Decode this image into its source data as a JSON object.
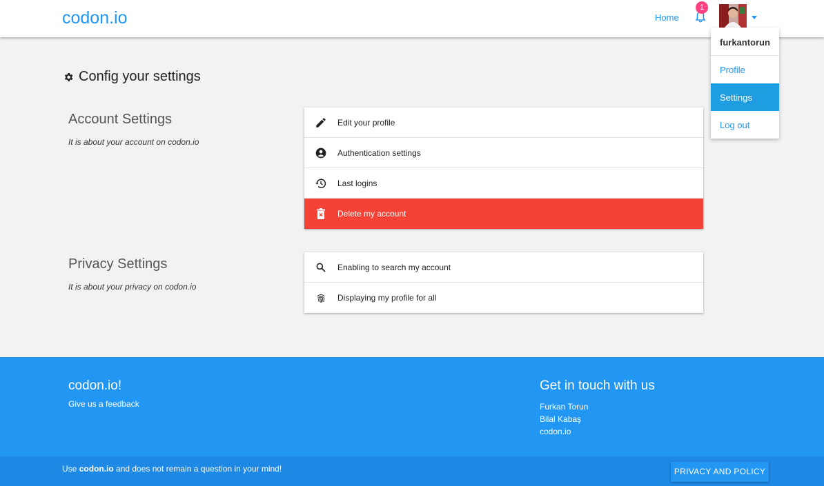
{
  "header": {
    "brand": "codon.io",
    "home_label": "Home",
    "notification_count": "1",
    "accent_color": "#2196f3",
    "badge_color": "#ff4081"
  },
  "user_menu": {
    "username": "furkantorun",
    "items": [
      {
        "label": "Profile",
        "active": false
      },
      {
        "label": "Settings",
        "active": true
      },
      {
        "label": "Log out",
        "active": false
      }
    ]
  },
  "main": {
    "heading": "Config your settings",
    "heading_icon": "gear-icon",
    "sections": [
      {
        "title": "Account Settings",
        "subtitle": "It is about your account on codon.io",
        "items": [
          {
            "label": "Edit your profile",
            "icon": "pencil-icon"
          },
          {
            "label": "Authentication settings",
            "icon": "account-circle-icon"
          },
          {
            "label": "Last logins",
            "icon": "history-icon"
          },
          {
            "label": "Delete my account",
            "icon": "trash-icon",
            "danger_color": "#f44336"
          }
        ]
      },
      {
        "title": "Privacy Settings",
        "subtitle": "It is about your privacy on codon.io",
        "items": [
          {
            "label": "Enabling to search my account",
            "icon": "search-icon"
          },
          {
            "label": "Displaying my profile for all",
            "icon": "fingerprint-icon"
          }
        ]
      }
    ]
  },
  "footer": {
    "brand": "codon.io!",
    "feedback": "Give us a feedback",
    "contact_title": "Get in touch with us",
    "contacts": [
      "Furkan Torun",
      "Bilal Kabaş",
      "codon.io"
    ],
    "tagline_prefix": "Use ",
    "tagline_brand": "codon.io",
    "tagline_suffix": " and does not remain a question in your mind!",
    "policy_button": "PRIVACY AND POLICY"
  }
}
